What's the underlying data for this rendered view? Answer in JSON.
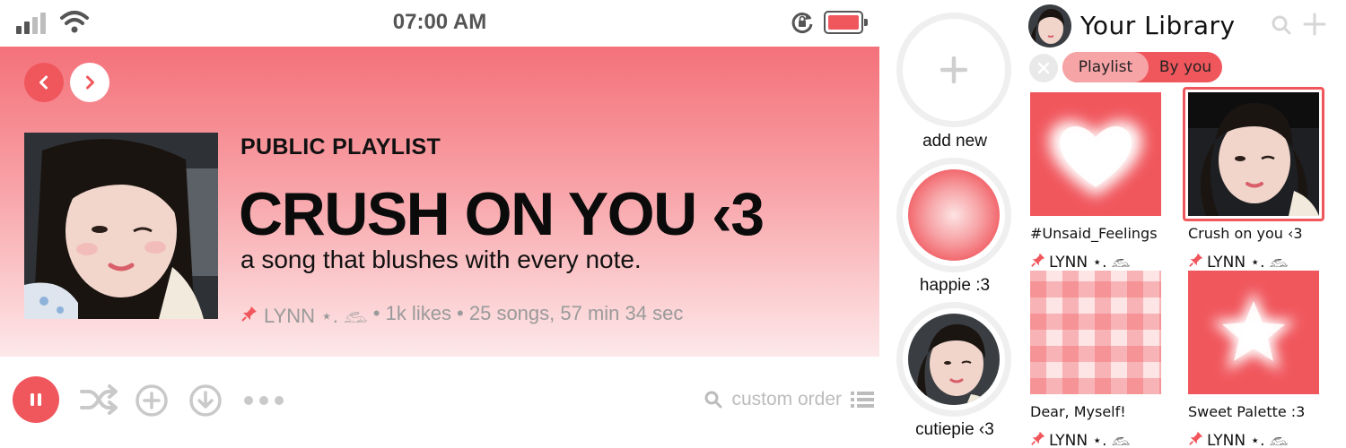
{
  "status_bar": {
    "time": "07:00 AM"
  },
  "playlist": {
    "type_label": "PUBLIC PLAYLIST",
    "title": "CRUSH ON YOU ‹3",
    "description": "a song that blushes with every note.",
    "owner": "LYNN ⋆. 𓃺",
    "meta": "• 1k likes • 25 songs, 57 min 34 sec"
  },
  "controls": {
    "sort_label": "custom order"
  },
  "quick_access": [
    {
      "label": "add new"
    },
    {
      "label": "happie :3"
    },
    {
      "label": "cutiepie ‹3"
    }
  ],
  "library": {
    "title": "Your Library",
    "filters": [
      "Playlist",
      "By you"
    ],
    "items": [
      {
        "title": "#Unsaid_Feelings",
        "owner": "LYNN ⋆. 𓃺",
        "art": "heart"
      },
      {
        "title": "Crush on you ‹3",
        "owner": "LYNN ⋆. 𓃺",
        "art": "photo"
      },
      {
        "title": "Dear, Myself!",
        "owner": "LYNN ⋆. 𓃺",
        "art": "plaid"
      },
      {
        "title": "Sweet Palette :3",
        "owner": "LYNN ⋆. 𓃺",
        "art": "star"
      }
    ]
  },
  "colors": {
    "accent": "#f0575d",
    "accent_light": "#f7a4a7",
    "hero_top": "#f4717a",
    "hero_bottom": "#fdeeef",
    "muted": "#9a9a9a",
    "icon_gray": "#c9c9c9"
  },
  "icons": [
    "signal-icon",
    "wifi-icon",
    "rotation-lock-icon",
    "battery-icon",
    "chevron-left-icon",
    "chevron-right-icon",
    "pin-icon",
    "pause-icon",
    "shuffle-icon",
    "add-circle-icon",
    "download-icon",
    "more-icon",
    "search-icon",
    "list-icon",
    "plus-icon",
    "close-icon"
  ]
}
